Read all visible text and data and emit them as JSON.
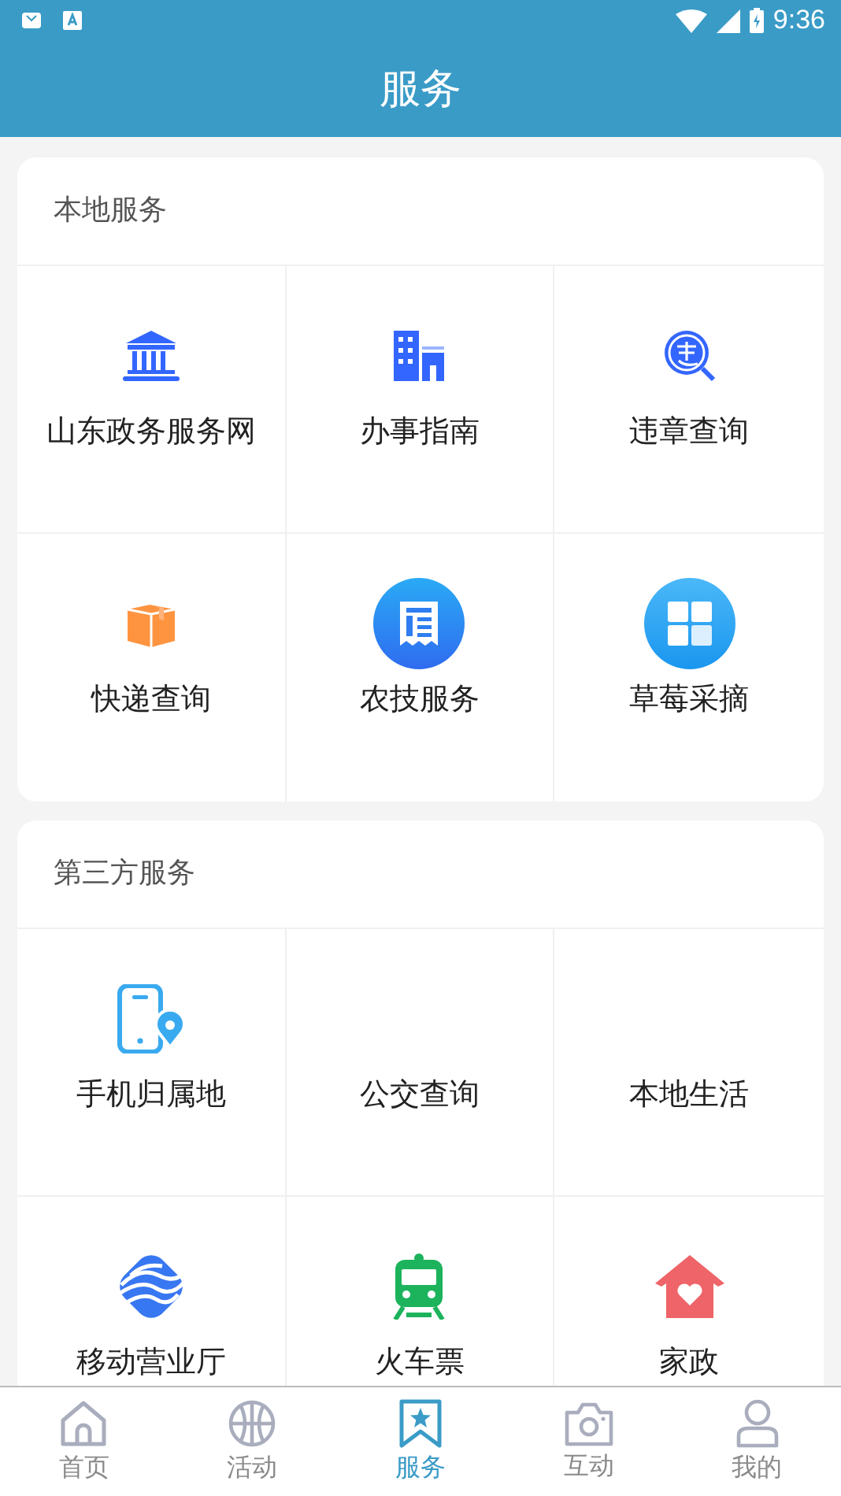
{
  "status_bar": {
    "time": "9:36"
  },
  "header": {
    "title": "服务"
  },
  "sections": [
    {
      "title": "本地服务",
      "items": [
        {
          "label": "山东政务服务网"
        },
        {
          "label": "办事指南"
        },
        {
          "label": "违章查询"
        },
        {
          "label": "快递查询"
        },
        {
          "label": "农技服务"
        },
        {
          "label": "草莓采摘"
        }
      ]
    },
    {
      "title": "第三方服务",
      "items": [
        {
          "label": "手机归属地"
        },
        {
          "label": "公交查询"
        },
        {
          "label": "本地生活"
        },
        {
          "label": "移动营业厅"
        },
        {
          "label": "火车票"
        },
        {
          "label": "家政"
        }
      ]
    }
  ],
  "tabs": [
    {
      "label": "首页",
      "selected": false
    },
    {
      "label": "活动",
      "selected": false
    },
    {
      "label": "服务",
      "selected": true
    },
    {
      "label": "互动",
      "selected": false
    },
    {
      "label": "我的",
      "selected": false
    }
  ]
}
